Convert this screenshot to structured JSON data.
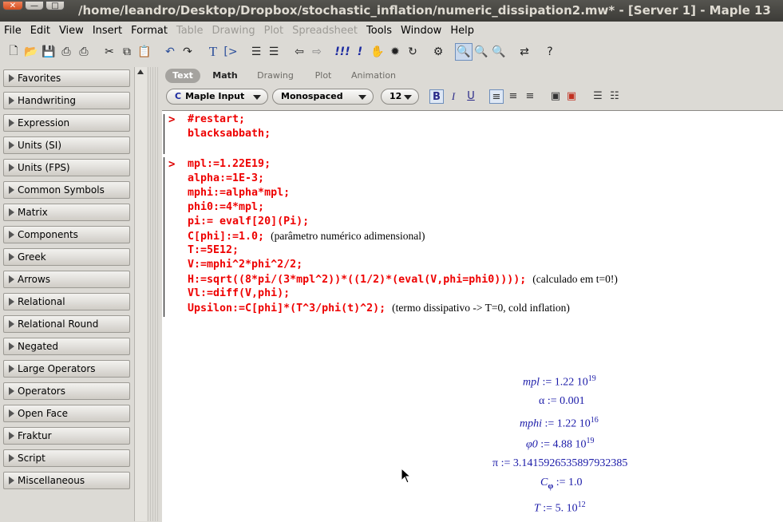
{
  "window": {
    "title": "/home/leandro/Desktop/Dropbox/stochastic_inflation/numeric_dissipation2.mw* - [Server 1] - Maple 13",
    "buttons": {
      "close": "✕",
      "minimize": "—",
      "maximize": "□"
    }
  },
  "menu": [
    "File",
    "Edit",
    "View",
    "Insert",
    "Format",
    "Table",
    "Drawing",
    "Plot",
    "Spreadsheet",
    "Tools",
    "Window",
    "Help"
  ],
  "menu_disabled": [
    "Table",
    "Drawing",
    "Plot",
    "Spreadsheet"
  ],
  "toolbar_icons": [
    "new-icon",
    "open-icon",
    "save-icon",
    "print-icon",
    "print-preview-icon",
    "cut-icon",
    "copy-icon",
    "paste-icon",
    "undo-icon",
    "redo-icon",
    "text-icon",
    "math-input-icon",
    "indent-icon",
    "outdent-icon",
    "back-icon",
    "forward-icon",
    "execute-all-icon",
    "execute-icon",
    "stop-icon",
    "debug-icon",
    "restart-icon",
    "settings-icon",
    "zoom-100-icon",
    "zoom-in-icon",
    "zoom-out-icon",
    "toggle-icon",
    "help-icon"
  ],
  "palettes": [
    "Favorites",
    "Handwriting",
    "Expression",
    "Units (SI)",
    "Units (FPS)",
    "Common Symbols",
    "Matrix",
    "Components",
    "Greek",
    "Arrows",
    "Relational",
    "Relational Round",
    "Negated",
    "Large Operators",
    "Operators",
    "Open Face",
    "Fraktur",
    "Script",
    "Miscellaneous"
  ],
  "context_tabs": [
    "Text",
    "Math",
    "Drawing",
    "Plot",
    "Animation"
  ],
  "context_bar": {
    "input_mode": "Maple Input",
    "font": "Monospaced",
    "size": "12",
    "bold": "B",
    "italic": "I",
    "underline": "U"
  },
  "exec_group_1": [
    "#restart;",
    "blacksabbath;"
  ],
  "exec_group_2": [
    {
      "code": "mpl:=1.22E19;",
      "comment": ""
    },
    {
      "code": "alpha:=1E-3;",
      "comment": ""
    },
    {
      "code": "mphi:=alpha*mpl;",
      "comment": ""
    },
    {
      "code": "phi0:=4*mpl;",
      "comment": ""
    },
    {
      "code": "pi:= evalf[20](Pi);",
      "comment": ""
    },
    {
      "code": "C[phi]:=1.0;",
      "comment": "(parâmetro numérico adimensional)"
    },
    {
      "code": "T:=5E12;",
      "comment": ""
    },
    {
      "code": "V:=mphi^2*phi^2/2;",
      "comment": ""
    },
    {
      "code": "H:=sqrt((8*pi/(3*mpl^2))*((1/2)*(eval(V,phi=phi0))));",
      "comment": "(calculado em t=0!)"
    },
    {
      "code": "Vl:=diff(V,phi);",
      "comment": ""
    },
    {
      "code": "Upsilon:=C[phi]*(T^3/phi(t)^2);",
      "comment": "(termo dissipativo -> T=0, cold inflation)"
    }
  ],
  "outputs": {
    "mpl": {
      "lhs": "mpl",
      "mant": "1.22 10",
      "exp": "19"
    },
    "alpha": {
      "lhs": "α",
      "val": "0.001"
    },
    "mphi": {
      "lhs": "mphi",
      "mant": "1.22 10",
      "exp": "16"
    },
    "phi0": {
      "lhs": "φ0",
      "mant": "4.88 10",
      "exp": "19"
    },
    "pi": {
      "lhs": "π",
      "val": "3.1415926535897932385"
    },
    "cphi": {
      "lhs": "C",
      "sub": "φ",
      "val": "1.0"
    },
    "T": {
      "lhs": "T",
      "mant": "5. 10",
      "exp": "12"
    }
  },
  "assign_op": ":="
}
